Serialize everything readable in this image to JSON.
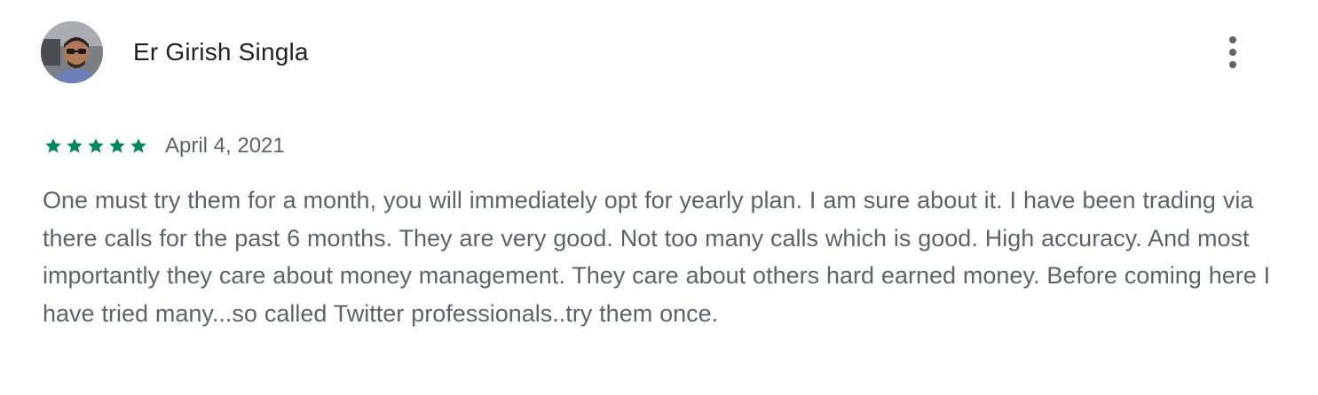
{
  "review": {
    "reviewer_name": "Er Girish Singla",
    "avatar_icon": "user-avatar-photo",
    "more_icon": "more-vert-icon",
    "rating": 5,
    "rating_max": 5,
    "star_color": "#01875f",
    "date": "April 4, 2021",
    "text": "One must try them for a month, you will immediately opt for yearly plan. I am sure about it. I have been trading via there calls for the past 6 months. They are very good. Not too many calls which is good. High accuracy. And most importantly they care about money management. They care about others hard earned money. Before coming here I have tried many...so called Twitter professionals..try them once."
  }
}
